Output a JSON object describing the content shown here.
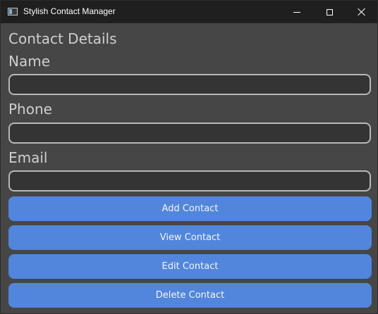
{
  "window": {
    "title": "Stylish Contact Manager",
    "icon": "app-window-icon",
    "controls": [
      "minimize-icon",
      "maximize-icon",
      "close-icon"
    ]
  },
  "form": {
    "heading": "Contact Details",
    "name_label": "Name",
    "name_value": "",
    "phone_label": "Phone",
    "phone_value": "",
    "email_label": "Email",
    "email_value": ""
  },
  "actions": {
    "add": "Add Contact",
    "view": "View Contact",
    "edit": "Edit Contact",
    "delete": "Delete Contact"
  },
  "colors": {
    "background": "#464646",
    "titlebar": "#1f1f1f",
    "input_fill": "#343434",
    "input_border": "#b8b8b8",
    "button": "#5286dc",
    "text": "#cfcfcf"
  }
}
